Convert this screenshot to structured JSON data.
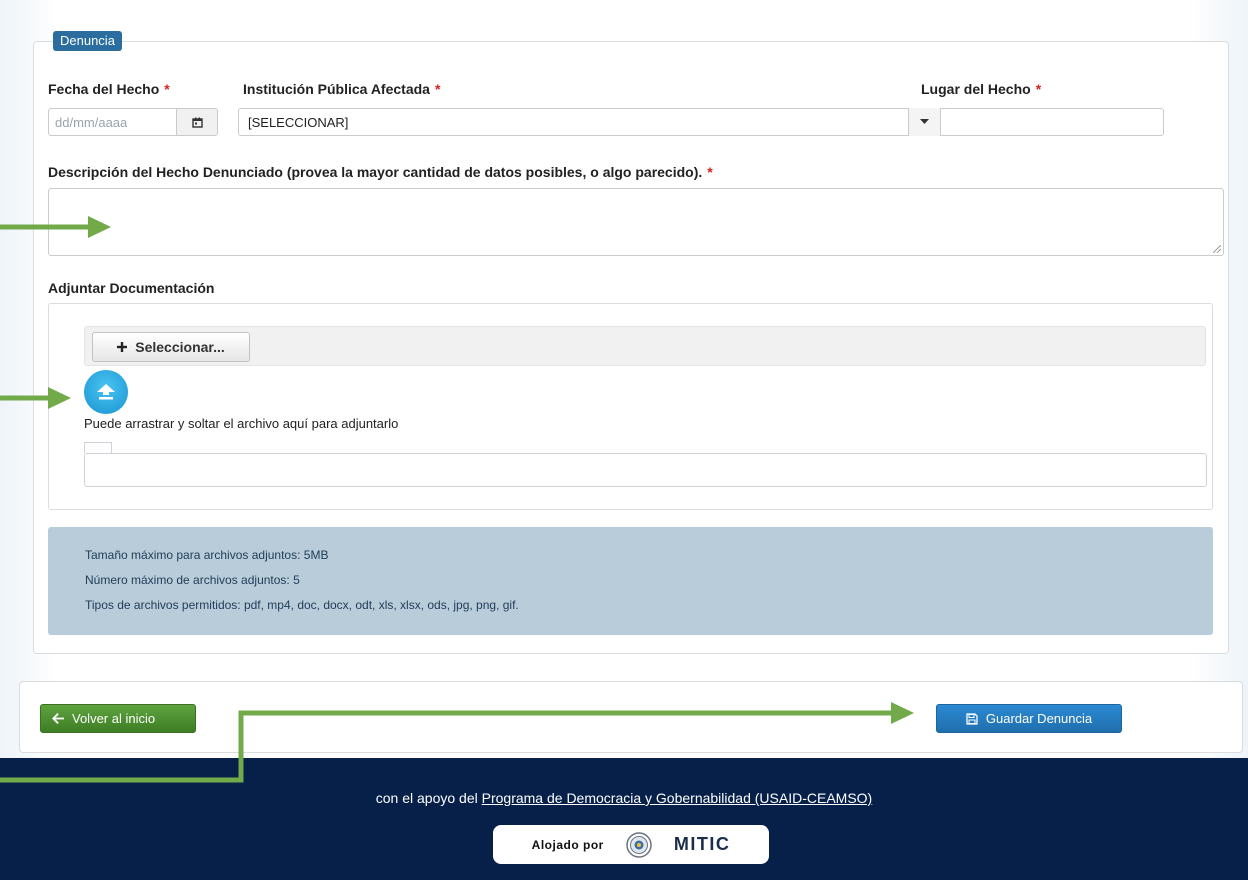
{
  "section": {
    "legend": "Denuncia"
  },
  "fields": {
    "fecha": {
      "label": "Fecha del Hecho",
      "placeholder": "dd/mm/aaaa",
      "required_mark": "*"
    },
    "institucion": {
      "label": "Institución Pública Afectada",
      "value": "[SELECCIONAR]",
      "required_mark": "*"
    },
    "lugar": {
      "label": "Lugar del Hecho",
      "value": "",
      "required_mark": "*"
    },
    "descripcion": {
      "label": "Descripción del Hecho Denunciado (provea la mayor cantidad de datos posibles, o algo parecido).",
      "value": "",
      "required_mark": "*"
    }
  },
  "attachments": {
    "heading": "Adjuntar Documentación",
    "select_button": "Seleccionar...",
    "select_icon": "plus-icon",
    "drop_hint": "Puede arrastrar y soltar el archivo aquí para adjuntarlo",
    "upload_icon": "upload-icon"
  },
  "info": {
    "lines": [
      "Tamaño máximo para archivos adjuntos: 5MB",
      "Número máximo de archivos adjuntos: 5",
      "Tipos de archivos permitidos: pdf, mp4, doc, docx, odt, xls, xlsx, ods, jpg, png, gif."
    ]
  },
  "actions": {
    "back_label": "Volver al inicio",
    "back_icon": "arrow-left-icon",
    "save_label": "Guardar Denuncia",
    "save_icon": "floppy-disk-icon"
  },
  "footer": {
    "support_prefix": "con el apoyo del",
    "support_link": "Programa de Democracia y Gobernabilidad (USAID-CEAMSO)",
    "hosted_label": "Alojado por",
    "hosted_brand": "MITIC"
  },
  "colors": {
    "legend": "#2a6d9e",
    "required": "#d9201e",
    "info_bg": "#b9ccd9",
    "back_button": "#4a8f30",
    "save_button": "#2580c3",
    "footer_bg": "#06204a",
    "annotation_arrow": "#72aa4a"
  }
}
